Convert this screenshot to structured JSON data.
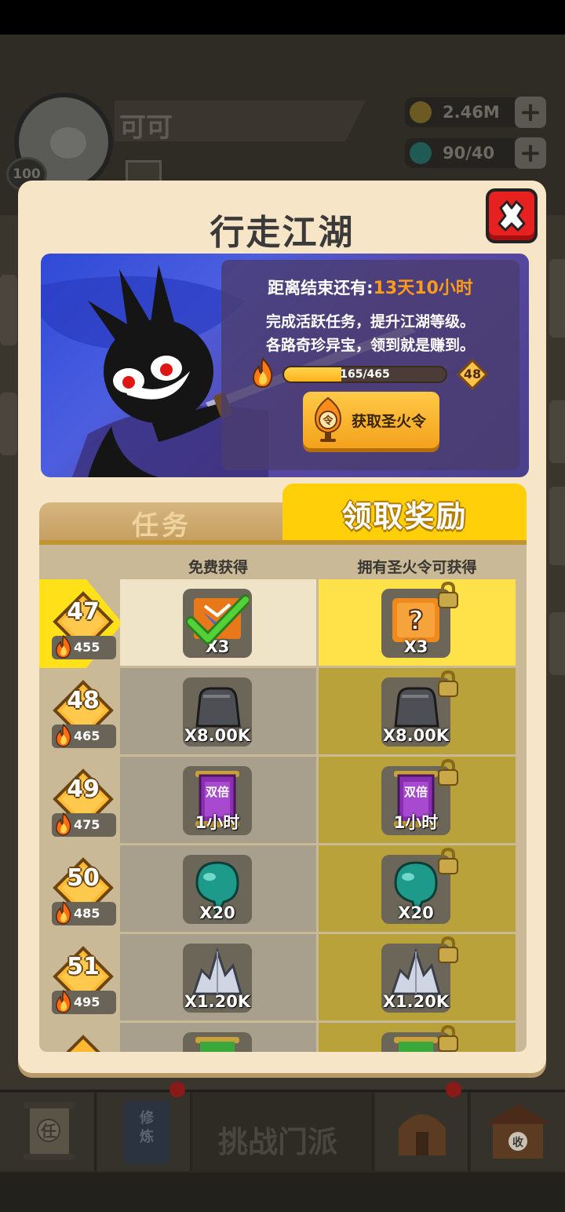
{
  "background": {
    "player_name": "可可",
    "player_level": "100",
    "coins": "2.46M",
    "gems": "90/40",
    "bottom_center": "挑战门派",
    "bottom_left_icon": "任",
    "bottom_book": "修炼",
    "bottom_right_icon": "收"
  },
  "dialog": {
    "title": "行走江湖",
    "banner": {
      "countdown_label": "距离结束还有:",
      "countdown_value": "13天10小时",
      "desc_line1": "完成活跃任务，提升江湖等级。",
      "desc_line2": "各路奇珍异宝，领到就是赚到。",
      "progress_text": "165/465",
      "progress_fraction": 0.355,
      "level": "48",
      "get_button": "获取圣火令",
      "token_char": "令"
    },
    "tabs": {
      "tasks": "任务",
      "rewards": "领取奖励"
    },
    "columns": {
      "free": "免费获得",
      "paid": "拥有圣火令可获得"
    },
    "rows": [
      {
        "level": "47",
        "fire": "455",
        "free_qty": "X3",
        "paid_qty": "X3",
        "free_item": "card-pack",
        "paid_item": "mystery-box",
        "claimed": true
      },
      {
        "level": "48",
        "fire": "465",
        "free_qty": "X8.00K",
        "paid_qty": "X8.00K",
        "free_item": "stone",
        "paid_item": "stone"
      },
      {
        "level": "49",
        "fire": "475",
        "free_qty": "1小时",
        "paid_qty": "1小时",
        "free_item": "double-scroll",
        "paid_item": "double-scroll",
        "scroll_label": "双倍"
      },
      {
        "level": "50",
        "fire": "485",
        "free_qty": "X20",
        "paid_qty": "X20",
        "free_item": "gem",
        "paid_item": "gem"
      },
      {
        "level": "51",
        "fire": "495",
        "free_qty": "X1.20K",
        "paid_qty": "X1.20K",
        "free_item": "crystal",
        "paid_item": "crystal"
      }
    ]
  }
}
